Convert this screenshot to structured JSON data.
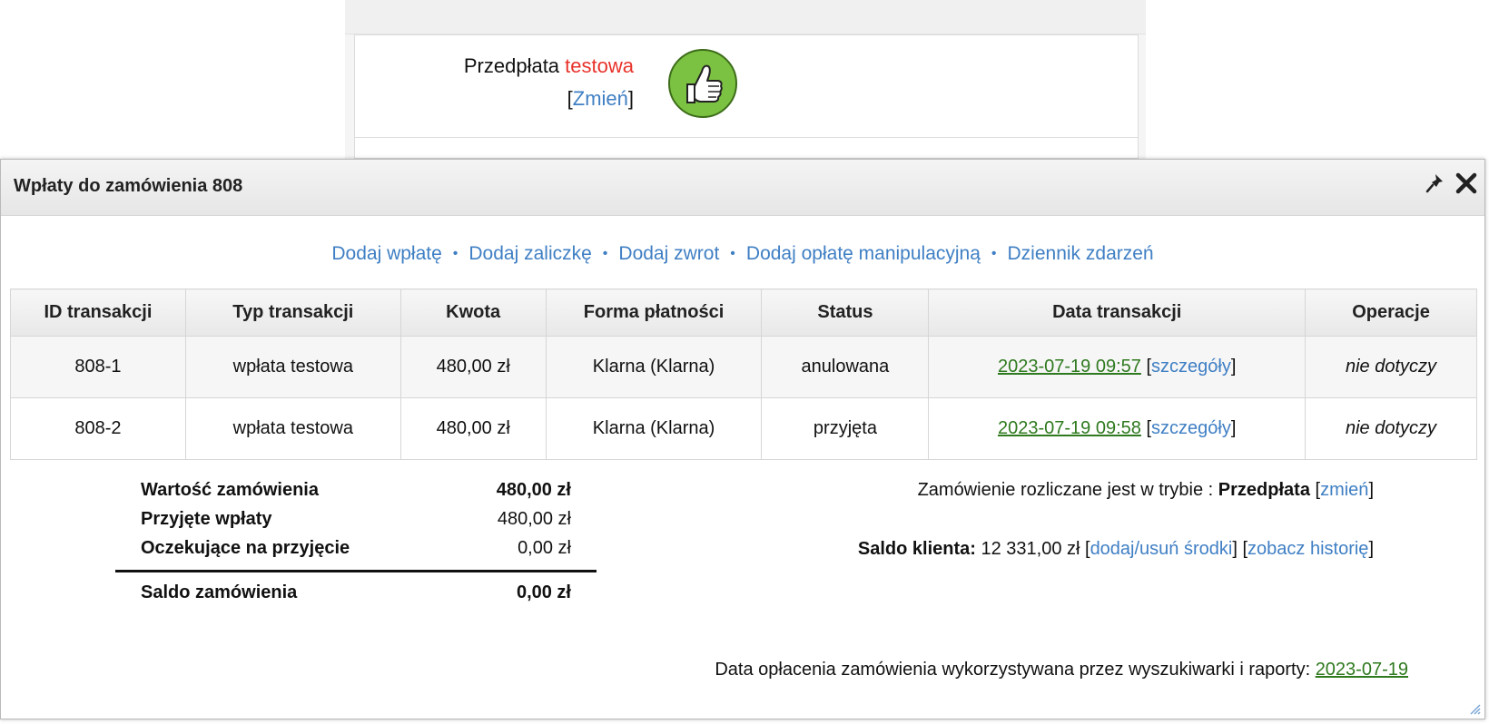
{
  "background": {
    "label_prefix": "Przedpłata",
    "label_highlight": "testowa",
    "change_link": "Zmień",
    "bracket_open": "[",
    "bracket_close": "]"
  },
  "dialog": {
    "title": "Wpłaty do zamówienia 808",
    "icons": [
      "pin-icon",
      "close-icon"
    ],
    "actions": [
      "Dodaj wpłatę",
      "Dodaj zaliczkę",
      "Dodaj zwrot",
      "Dodaj opłatę manipulacyjną",
      "Dziennik zdarzeń"
    ],
    "action_separator": "•",
    "table": {
      "headers": [
        "ID transakcji",
        "Typ transakcji",
        "Kwota",
        "Forma płatności",
        "Status",
        "Data transakcji",
        "Operacje"
      ],
      "rows": [
        {
          "id": "808-1",
          "type": "wpłata testowa",
          "amount": "480,00 zł",
          "method": "Klarna (Klarna)",
          "status": "anulowana",
          "date": "2023-07-19 09:57",
          "details": "szczegóły",
          "operations": "nie dotyczy"
        },
        {
          "id": "808-2",
          "type": "wpłata testowa",
          "amount": "480,00 zł",
          "method": "Klarna (Klarna)",
          "status": "przyjęta",
          "date": "2023-07-19 09:58",
          "details": "szczegóły",
          "operations": "nie dotyczy"
        }
      ]
    },
    "summary": {
      "order_value_label": "Wartość zamówienia",
      "order_value": "480,00 zł",
      "accepted_label": "Przyjęte wpłaty",
      "accepted": "480,00 zł",
      "pending_label": "Oczekujące na przyjęcie",
      "pending": "0,00 zł",
      "balance_label": "Saldo zamówienia",
      "balance": "0,00 zł"
    },
    "mode": {
      "text": "Zamówienie rozliczane jest w trybie : ",
      "value": "Przedpłata",
      "change_link": "zmień"
    },
    "client_balance": {
      "label": "Saldo klienta:",
      "value": " 12 331,00 zł ",
      "add_remove_link": "dodaj/usuń środki",
      "history_link": "zobacz historię"
    },
    "paid_date": {
      "text": "Data opłacenia zamówienia wykorzystywana przez wyszukiwarki i raporty: ",
      "date": "2023-07-19"
    },
    "colors": {
      "link": "#3f7fc4",
      "test_red": "#e8322a",
      "date_green": "#2f7a1f",
      "thumb_green": "#7cc242"
    }
  }
}
